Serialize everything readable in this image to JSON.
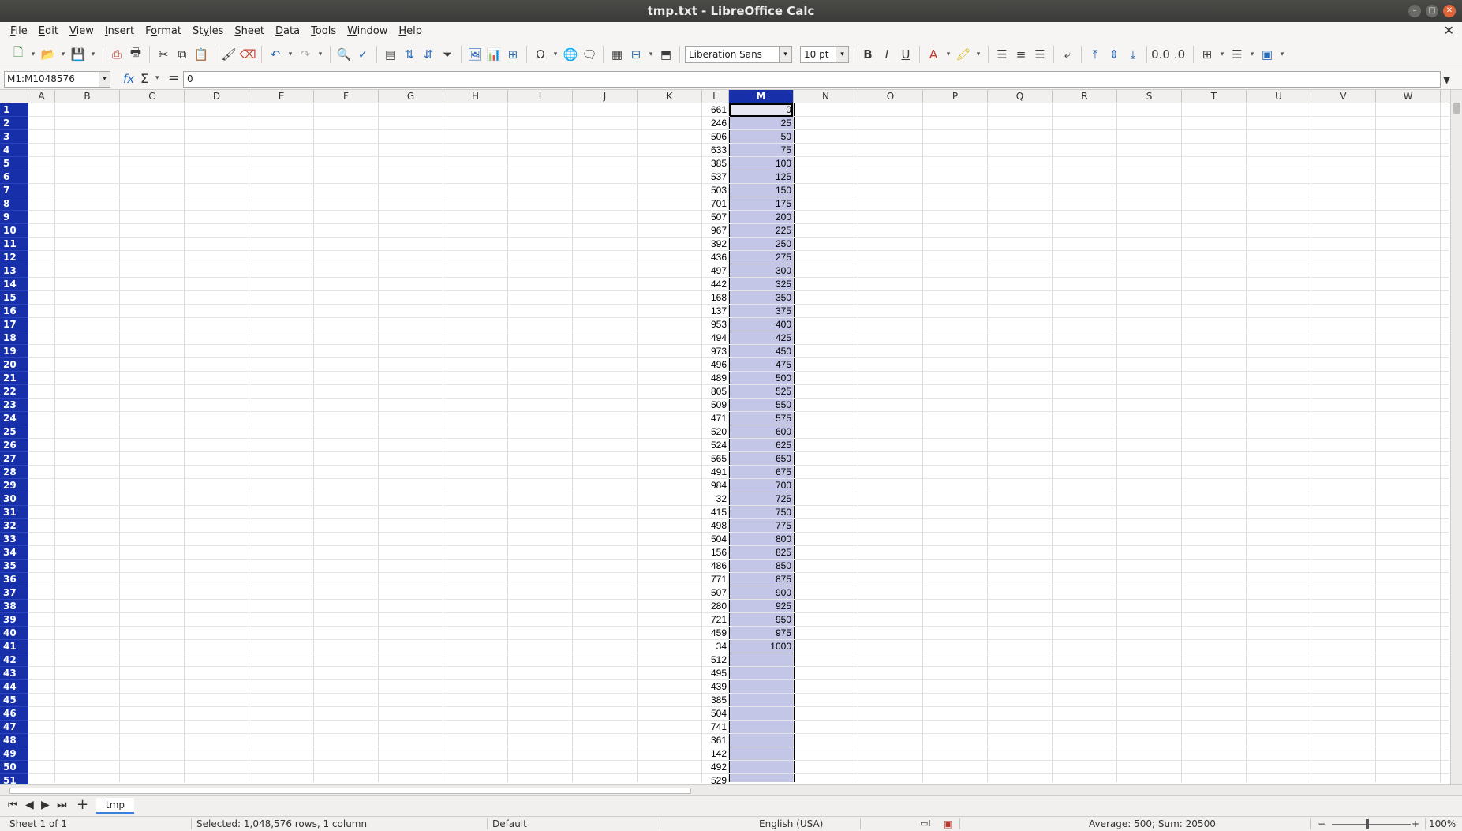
{
  "window": {
    "title": "tmp.txt - LibreOffice Calc"
  },
  "menu": [
    "File",
    "Edit",
    "View",
    "Insert",
    "Format",
    "Styles",
    "Sheet",
    "Data",
    "Tools",
    "Window",
    "Help"
  ],
  "menu_accel": [
    "F",
    "E",
    "V",
    "I",
    "o",
    "y",
    "S",
    "D",
    "T",
    "W",
    "H"
  ],
  "toolbar": {
    "font_name": "Liberation Sans",
    "font_size": "10 pt",
    "bold": "B",
    "italic": "I",
    "underline": "U"
  },
  "formula_bar": {
    "name_box": "M1:M1048576",
    "content": "0"
  },
  "columns": [
    "A",
    "B",
    "C",
    "D",
    "E",
    "F",
    "G",
    "H",
    "I",
    "J",
    "K",
    "L",
    "M",
    "N",
    "O",
    "P",
    "Q",
    "R",
    "S",
    "T",
    "U",
    "V",
    "W"
  ],
  "selected_column": "M",
  "rows": [
    "1",
    "2",
    "3",
    "4",
    "5",
    "6",
    "7",
    "8",
    "9",
    "10",
    "11",
    "12",
    "13",
    "14",
    "15",
    "16",
    "17",
    "18",
    "19",
    "20",
    "21",
    "22",
    "23",
    "24",
    "25",
    "26",
    "27",
    "28",
    "29",
    "30",
    "31",
    "32",
    "33",
    "34",
    "35",
    "36",
    "37",
    "38",
    "39",
    "40",
    "41",
    "42",
    "43",
    "44",
    "45",
    "46",
    "47",
    "48",
    "49",
    "50",
    "51"
  ],
  "col_L": [
    "661",
    "246",
    "506",
    "633",
    "385",
    "537",
    "503",
    "701",
    "507",
    "967",
    "392",
    "436",
    "497",
    "442",
    "168",
    "137",
    "953",
    "494",
    "973",
    "496",
    "489",
    "805",
    "509",
    "471",
    "520",
    "524",
    "565",
    "491",
    "984",
    "32",
    "415",
    "498",
    "504",
    "156",
    "486",
    "771",
    "507",
    "280",
    "721",
    "459",
    "34",
    "512",
    "495",
    "439",
    "385",
    "504",
    "741",
    "361",
    "142",
    "492",
    "529"
  ],
  "col_M": [
    "0",
    "25",
    "50",
    "75",
    "100",
    "125",
    "150",
    "175",
    "200",
    "225",
    "250",
    "275",
    "300",
    "325",
    "350",
    "375",
    "400",
    "425",
    "450",
    "475",
    "500",
    "525",
    "550",
    "575",
    "600",
    "625",
    "650",
    "675",
    "700",
    "725",
    "750",
    "775",
    "800",
    "825",
    "850",
    "875",
    "900",
    "925",
    "950",
    "975",
    "1000"
  ],
  "sheet_tab": "tmp",
  "status": {
    "sheet": "Sheet 1 of 1",
    "selection": "Selected: 1,048,576 rows, 1 column",
    "style": "Default",
    "language": "English (USA)",
    "aggregate": "Average: 500; Sum: 20500",
    "zoom": "100%"
  },
  "colors": {
    "selection_header": "#172fa8",
    "selection_fill": "#c3c6e6"
  }
}
